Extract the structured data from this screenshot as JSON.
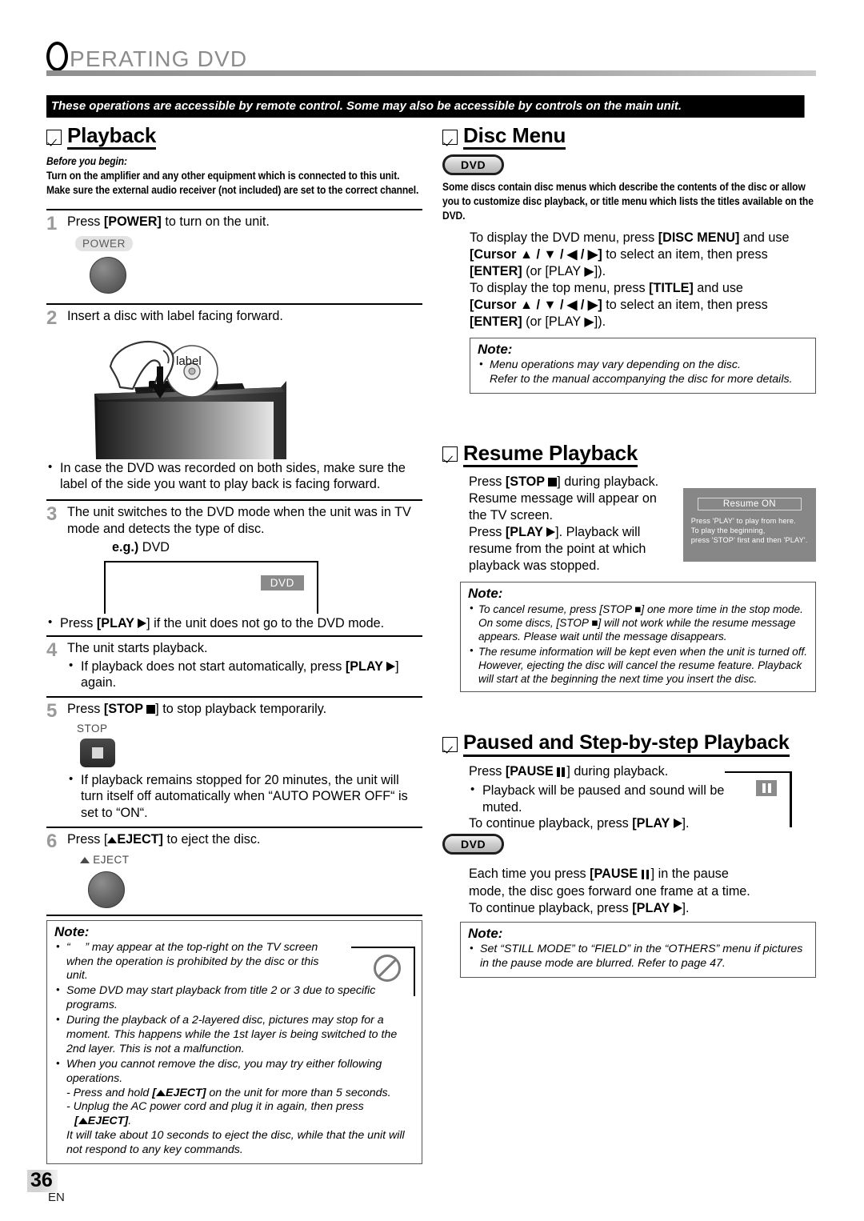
{
  "header": {
    "title_first_letter": "O",
    "title_rest": "PERATING  DVD",
    "banner": "These operations are accessible by remote control. Some may also be accessible by controls on the main unit."
  },
  "left": {
    "playback": {
      "heading": "Playback",
      "before_label": "Before you begin:",
      "before_line1": "Turn on the amplifier and any other equipment which is connected to this unit.",
      "before_line2": "Make sure the external audio receiver (not included) are set to the correct channel.",
      "steps": [
        {
          "num": "1",
          "text_pre": "Press ",
          "key": "[POWER]",
          "text_post": " to turn on the unit.",
          "button_label": "POWER"
        },
        {
          "num": "2",
          "text": "Insert a disc with label facing forward.",
          "illustration_label": "label",
          "bullet": "In case the DVD was recorded on both sides, make sure the label of the side you want to play back is facing forward."
        },
        {
          "num": "3",
          "text": "The unit switches to the DVD mode when the unit was in TV mode and detects the type of disc.",
          "eg_bold": "e.g.)",
          "eg_rest": " DVD",
          "osd_chip": "DVD",
          "bullet_pre": "Press ",
          "bullet_key": "[PLAY ",
          "bullet_post": "] if the unit does not go to the DVD mode."
        },
        {
          "num": "4",
          "text": "The unit starts playback.",
          "bullet_pre": "If playback does not start automatically, press ",
          "bullet_key": "[PLAY ",
          "bullet_post": "] again."
        },
        {
          "num": "5",
          "text_pre": "Press ",
          "key": "[STOP ",
          "text_post": "] to stop playback temporarily.",
          "button_label": "STOP",
          "bullet": "If playback remains stopped for 20 minutes, the unit will turn itself off automatically when “AUTO POWER OFF“ is set to “ON“."
        },
        {
          "num": "6",
          "text_pre": "Press [",
          "key": "EJECT]",
          "text_post": " to eject the disc.",
          "button_label": "EJECT"
        }
      ],
      "note": {
        "title": "Note:",
        "items": [
          "“ ⃝ ” may appear at the top-right on the TV screen when the operation is prohibited by the disc or this unit.",
          "Some DVD may start playback from title 2 or 3 due to specific programs.",
          "During the playback of a 2-layered disc, pictures may stop for a moment. This happens while the 1st layer is being switched to the 2nd layer. This is not a malfunction.",
          "When you cannot remove the disc, you may try either following operations."
        ],
        "sub_lines": [
          "- Press and hold [▲EJECT] on the unit for more than 5 seconds.",
          "- Unplug the AC power cord and plug it in again, then press",
          "[▲EJECT].",
          "It will take about 10 seconds to eject the disc, while that the unit will not respond to any key commands."
        ]
      }
    }
  },
  "right": {
    "disc_menu": {
      "heading": "Disc Menu",
      "badge": "DVD",
      "intro": "Some discs contain disc menus which describe the contents of the disc or allow you to customize disc playback, or title menu which lists the titles available on the DVD.",
      "body_lines": [
        {
          "pre": "To display the DVD menu, press ",
          "key": "[DISC MENU]",
          "post": " and use"
        },
        {
          "pre": "",
          "key": "[Cursor ▲ / ▼ / ◀ / ▶]",
          "post": " to select an item, then press"
        },
        {
          "pre": "",
          "key": "[ENTER]",
          "post": " (or [PLAY ▶])."
        },
        {
          "pre": "To display the top menu, press ",
          "key": "[TITLE]",
          "post": " and use"
        },
        {
          "pre": "",
          "key": "[Cursor ▲ / ▼ / ◀ / ▶]",
          "post": " to select an item, then press"
        },
        {
          "pre": "",
          "key": "[ENTER]",
          "post": " (or [PLAY ▶])."
        }
      ],
      "note": {
        "title": "Note:",
        "item1": "Menu operations may vary depending on the disc.",
        "item1_cont": "Refer to the manual accompanying the disc for more details."
      }
    },
    "resume_playback": {
      "heading": "Resume Playback",
      "line1_pre": "Press ",
      "line1_key": "[STOP ",
      "line1_post": "] during playback.",
      "line2": "Resume message will appear on",
      "line3": "the TV screen.",
      "line4_pre": "Press ",
      "line4_key": "[PLAY ",
      "line4_post": "]. Playback will",
      "line5": "resume from the point at which",
      "line6": "playback was stopped.",
      "screen": {
        "title": "Resume ON",
        "line1": "Press 'PLAY' to play from here.",
        "line2": "To play the beginning,",
        "line3": "press 'STOP' first and then 'PLAY'."
      },
      "note": {
        "title": "Note:",
        "items": [
          "To cancel resume, press [STOP ■] one more time in the stop mode. On some discs, [STOP ■] will not work while the resume message appears. Please wait until the message disappears.",
          "The resume information will be kept even when the unit is turned off. However, ejecting the disc will cancel the resume feature. Playback will start at the beginning the next time you insert the disc."
        ]
      }
    },
    "paused_step": {
      "heading": "Paused and Step-by-step Playback",
      "line1_pre": "Press ",
      "line1_key": "[PAUSE ",
      "line1_post": "] during playback.",
      "bullet": "Playback will be paused and sound will be muted.",
      "line2_pre": "To continue playback, press ",
      "line2_key": "[PLAY ",
      "line2_post": "].",
      "badge": "DVD",
      "para_pre": "Each time you press ",
      "para_key": "[PAUSE ",
      "para_post": "] in the pause mode, the disc goes forward one frame at a time.",
      "para2_pre": "To continue playback, press ",
      "para2_key": "[PLAY ",
      "para2_post": "].",
      "note": {
        "title": "Note:",
        "item": "Set “STILL MODE” to “FIELD” in the “OTHERS” menu if pictures in the pause mode are blurred. Refer to page 47."
      }
    }
  },
  "footer": {
    "page_number": "36",
    "language": "EN"
  }
}
